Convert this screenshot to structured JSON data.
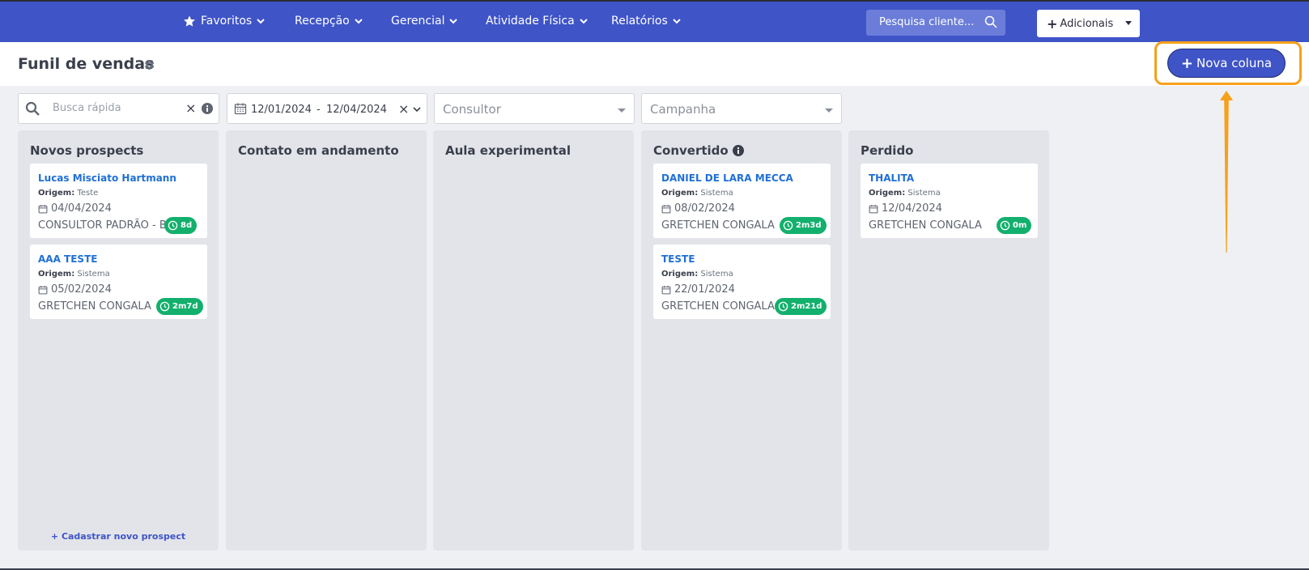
{
  "nav": {
    "items": [
      "Favoritos",
      "Recepção",
      "Gerencial",
      "Atividade Física",
      "Relatórios"
    ],
    "search_placeholder": "Pesquisa cliente...",
    "add_label": "Adicionais"
  },
  "header": {
    "title": "Funil de vendas",
    "new_column_label": "Nova coluna"
  },
  "filters": {
    "quick_search_placeholder": "Busca rápida",
    "date_from": "12/01/2024",
    "date_separator": "-",
    "date_to": "12/04/2024",
    "consultant_placeholder": "Consultor",
    "campaign_placeholder": "Campanha",
    "clear_symbol": "×"
  },
  "columns": [
    {
      "title": "Novos prospects",
      "cards": [
        {
          "name": "Lucas Misciato Hartmann",
          "origin_label": "Origem:",
          "origin": "Teste",
          "date": "04/04/2024",
          "consultant": "CONSULTOR PADRÃO - B...",
          "badge": "8d"
        },
        {
          "name": "AAA TESTE",
          "origin_label": "Origem:",
          "origin": "Sistema",
          "date": "05/02/2024",
          "consultant": "GRETCHEN CONGALA",
          "badge": "2m7d"
        }
      ],
      "footer": "Cadastrar novo prospect"
    },
    {
      "title": "Contato em andamento",
      "cards": []
    },
    {
      "title": "Aula experimental",
      "cards": []
    },
    {
      "title": "Convertido",
      "cards": [
        {
          "name": "DANIEL DE LARA MECCA",
          "origin_label": "Origem:",
          "origin": "Sistema",
          "date": "08/02/2024",
          "consultant": "GRETCHEN CONGALA",
          "badge": "2m3d"
        },
        {
          "name": "TESTE",
          "origin_label": "Origem:",
          "origin": "Sistema",
          "date": "22/01/2024",
          "consultant": "GRETCHEN CONGALA",
          "badge": "2m21d"
        }
      ]
    },
    {
      "title": "Perdido",
      "cards": [
        {
          "name": "THALITA",
          "origin_label": "Origem:",
          "origin": "Sistema",
          "date": "12/04/2024",
          "consultant": "GRETCHEN CONGALA",
          "badge": "0m"
        }
      ]
    }
  ],
  "colors": {
    "nav_bg": "#3f54c7",
    "accent_orange": "#f7a01a",
    "badge_green": "#12b06c",
    "link_blue": "#1f6fd6"
  }
}
